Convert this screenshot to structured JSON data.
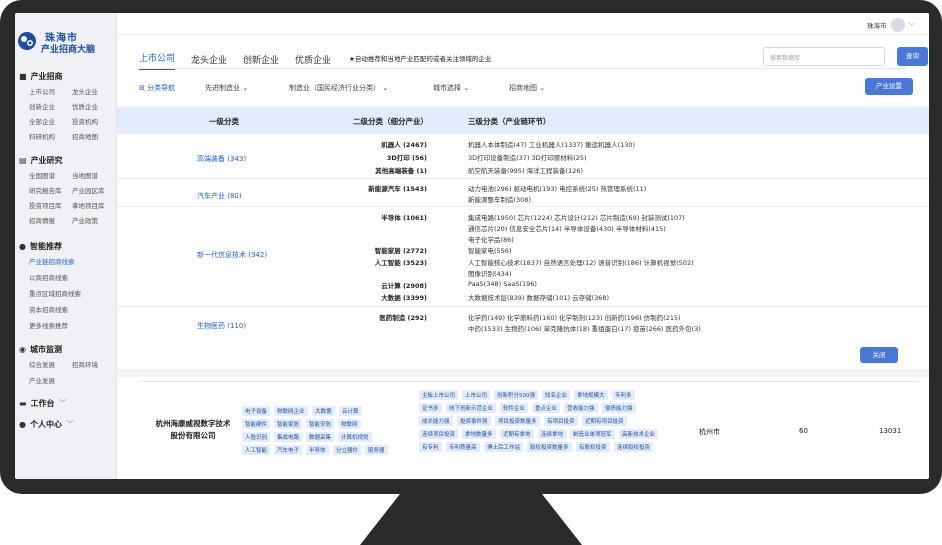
{
  "app": {
    "title_line1": "珠海市",
    "title_line2": "产业招商大脑"
  },
  "topbar": {
    "user": "珠海市"
  },
  "sidebar": {
    "sections": [
      {
        "title": "产业招商",
        "items": [
          "上市公司",
          "龙头企业",
          "创新企业",
          "优质企业",
          "全部企业",
          "投资机构",
          "科研机构",
          "招商地图"
        ]
      },
      {
        "title": "产业研究",
        "items": [
          "全国图谱",
          "当地图谱",
          "研究报告库",
          "产业园区库",
          "投资项目库",
          "拿地项目库",
          "招商情报",
          "产业政策"
        ]
      },
      {
        "title": "智能推荐",
        "items": [
          "产业链招商线索",
          "以商招商线索",
          "重点区域招商线索",
          "资本招商线索",
          "更多线索推荐"
        ]
      },
      {
        "title": "城市监测",
        "items": [
          "综合发展",
          "招商环境",
          "产业发展"
        ]
      },
      {
        "title": "工作台"
      },
      {
        "title": "个人中心"
      }
    ]
  },
  "tabs": [
    "上市公司",
    "龙头企业",
    "创新企业",
    "优质企业"
  ],
  "hint": "★自动推荐和当地产业匹配的或者关注领域的企业",
  "search": {
    "placeholder": "搜索数据库",
    "button": "查询"
  },
  "filters": {
    "nav": "分类导航",
    "f1": "先进制造业",
    "f2": "制造业（国民经济行业分类）",
    "f3": "城市选择",
    "f4": "招商地图",
    "setting": "产业设置"
  },
  "table": {
    "headers": [
      "一级分类",
      "二级分类（细分产业）",
      "三级分类（产业链环节）"
    ],
    "close": "关闭",
    "rows": [
      {
        "l1": "高端装备 (343)",
        "subs": [
          {
            "name": "机器人 (2467)",
            "items": "机器人本体制造(47)  工业机器人(1337)  搬运机器人(130)"
          },
          {
            "name": "3D打印 (56)",
            "items": "3D打印设备制造(37)  3D打印原材料(25)"
          },
          {
            "name": "其他高端装备 (1)",
            "items": "航空航天装备(995)  海洋工程装备(126)"
          }
        ]
      },
      {
        "l1": "汽车产业 (80)",
        "subs": [
          {
            "name": "新能源汽车 (1543)",
            "items": "动力电池(296)  驱动电机(193)  电控系统(25)  热管理系统(11)",
            "items2": "新能源整车制造(308)"
          }
        ]
      },
      {
        "l1": "新一代信息技术 (342)",
        "subs": [
          {
            "name": "半导体 (1061)",
            "items": "集成电路(1950)  芯片(1224)  芯片设计(212)  芯片制造(69)  封装测试(107)",
            "items2": "通信芯片(20)  信息安全芯片(14)  半导体设备(430)  半导体材料(415)",
            "items3": "电子化学品(86)"
          },
          {
            "name": "智能家居 (2772)",
            "items": "智能家电(556)"
          },
          {
            "name": "人工智能 (3523)",
            "items": "人工智能核心技术(1837)  自然语言处理(12)  语音识别(186)  计算机视觉(502)",
            "items2": "图像识别(434)"
          },
          {
            "name": "云计算 (2908)",
            "items": "PaaS(348)  SaaS(196)"
          },
          {
            "name": "大数据 (3399)",
            "items": "大数据技术层(839)  数据存储(101)  云存储(368)"
          }
        ]
      },
      {
        "l1": "生物医药 (110)",
        "subs": [
          {
            "name": "医药制造 (292)",
            "items": "化学药(149)  化学原料药(160)  化学制剂(123)  创新药(196)  仿制药(215)",
            "items2": "中药(1533)  生物药(106)  单克隆抗体(18)  重组蛋白(17)  疫苗(266)  医药外包(3)"
          }
        ]
      }
    ]
  },
  "company": {
    "name": "杭州海康威视数字技术股份有限公司",
    "industry_tags": [
      "电子设备",
      "物联网企业",
      "大数据",
      "云计算",
      "智能硬件",
      "智能家居",
      "智能安防",
      "物联网",
      "人脸识别",
      "集成电路",
      "数据采集",
      "计算机视觉",
      "人工智能",
      "汽车电子",
      "半导体",
      "分立器件",
      "服务器"
    ],
    "status_tags": [
      "主板上市公司",
      "上市公司",
      "创新积分500强",
      "知名企业",
      "拿地规模大",
      "专利多",
      "证书多",
      "线下创新示范企业",
      "软件企业",
      "重点企业",
      "营收能力强",
      "偿债能力强",
      "成长能力强",
      "投资事件强",
      "项目投资数量多",
      "有项目投资",
      "近期有项目投资",
      "连续项目投资",
      "拿地数量多",
      "近期有拿地",
      "连续拿地",
      "制造业单项冠军",
      "高新技术企业",
      "有专利",
      "专利质量高",
      "博士后工作站",
      "股权投资数量多",
      "有股权投资",
      "连续股权投资"
    ],
    "city": "杭州市",
    "count": "60",
    "value": "13031"
  }
}
